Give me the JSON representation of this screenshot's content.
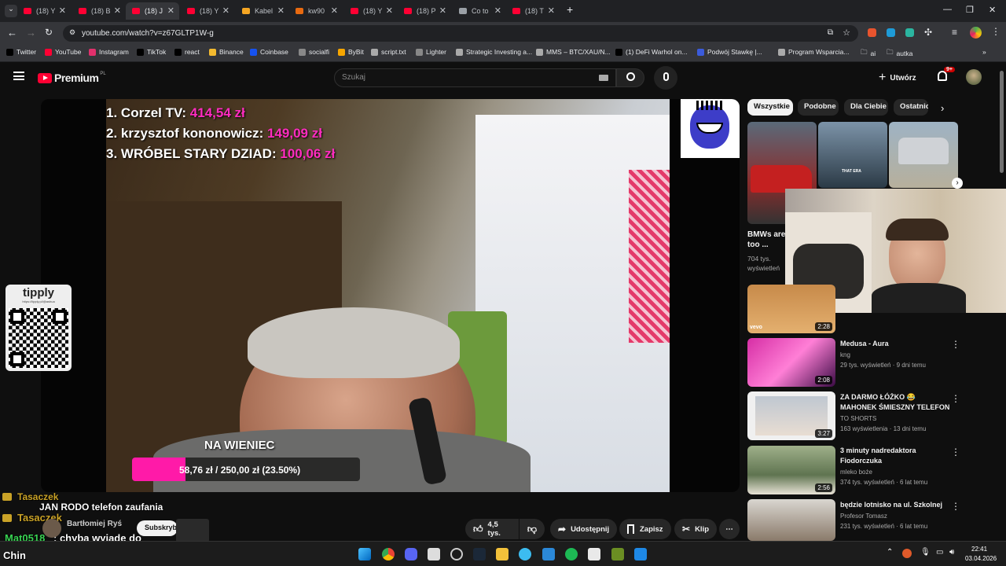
{
  "browser": {
    "tabs": [
      {
        "label": "(18) Y",
        "fav": "#ff0033"
      },
      {
        "label": "(18) B",
        "fav": "#ff0033"
      },
      {
        "label": "(18) J",
        "fav": "#ff0033"
      },
      {
        "label": "(18) Y",
        "fav": "#ff0033"
      },
      {
        "label": "Kabel",
        "fav": "#f5a623"
      },
      {
        "label": "kw90",
        "fav": "#e86a10"
      },
      {
        "label": "(18) Y",
        "fav": "#ff0033"
      },
      {
        "label": "(18) P",
        "fav": "#ff0033"
      },
      {
        "label": "Co to",
        "fav": "#9aa0a6"
      },
      {
        "label": "(18) T",
        "fav": "#ff0033"
      }
    ],
    "url": "youtube.com/watch?v=z67GLTP1W-g",
    "bookmarks": [
      "Twitter",
      "YouTube",
      "Instagram",
      "TikTok",
      "react",
      "Binance",
      "Coinbase",
      "socialfi",
      "ByBit",
      "script.txt",
      "Lighter",
      "Strategic Investing a...",
      "MMS – BTC/XAU/N...",
      "(1) DeFi Warhol on...",
      "Podwój Stawkę |...",
      "Program Wsparcia..."
    ],
    "bookmark_folders": [
      "ai",
      "autka"
    ]
  },
  "youtube": {
    "logo": "Premium",
    "logo_badge": "PL",
    "search_placeholder": "Szukaj",
    "create_label": "Utwórz",
    "notif_count": "9+",
    "chips": [
      "Wszystkie",
      "Podobne",
      "Dla Ciebie",
      "Ostatnio"
    ],
    "actions": {
      "likes": "4,5 tys.",
      "share": "Udostępnij",
      "save": "Zapisz",
      "clip": "Klip"
    },
    "channel": {
      "name": "Bartłomiej Ryś",
      "subscribe": "Subskrybuj"
    }
  },
  "overlay": {
    "leaderboard": [
      {
        "rank": "1.",
        "name": "Corzel TV:",
        "amount": "414,54 zł"
      },
      {
        "rank": "2.",
        "name": "krzysztof kononowicz:",
        "amount": "149,09 zł"
      },
      {
        "rank": "3.",
        "name": "WRÓBEL STARY DZIAD:",
        "amount": "100,06 zł"
      }
    ],
    "goal_label": "NA WIENIEC",
    "goal_text": "58,76 zł / 250,00 zł (23.50%)",
    "goal_fraction": 0.235,
    "tipply": "tipply",
    "tipply_url": "https://tipply.pl/@ashua"
  },
  "chat": [
    {
      "user": "Tasaczek",
      "msg": "",
      "color": "#c9a227"
    },
    {
      "user": "",
      "msg": "JAN RODO telefon zaufania",
      "color": "#ffffff"
    },
    {
      "user": "Tasaczek",
      "msg": "",
      "color": "#c9a227"
    },
    {
      "user": "Mat0518",
      "msg": ": chyba wyjade do",
      "color": "#39d353"
    },
    {
      "user": "",
      "msg": "Chin",
      "color": "#ffffff"
    }
  ],
  "recommended": [
    {
      "title": "BMWs are too ...",
      "views": "704 tys. wyświetleń",
      "duration": ""
    },
    {
      "title": "",
      "views": "",
      "duration": "2:28",
      "badge": "vevo"
    },
    {
      "title": "Medusa - Aura",
      "channel": "kng",
      "views": "29 tys. wyświetleń · 9 dni temu",
      "duration": "2:08"
    },
    {
      "title": "ZA DARMO ŁÓŻKO 😂 MAHONEK ŚMIESZNY TELEFON",
      "channel": "TO SHORTS",
      "views": "163 wyświetlenia · 13 dni temu",
      "duration": "3:27"
    },
    {
      "title": "3 minuty nadredaktora Fiodorczuka",
      "channel": "mleko boże",
      "views": "374 tys. wyświetleń · 6 lat temu",
      "duration": "2:56"
    },
    {
      "title": "będzie lotnisko na ul. Szkolnej",
      "channel": "Profesor Tomasz",
      "views": "231 tys. wyświetleń · 6 lat temu",
      "duration": ""
    }
  ],
  "thumb_caption": "THAT ERA",
  "taskbar": {
    "time": "22:41",
    "date": "03.04.2026"
  }
}
